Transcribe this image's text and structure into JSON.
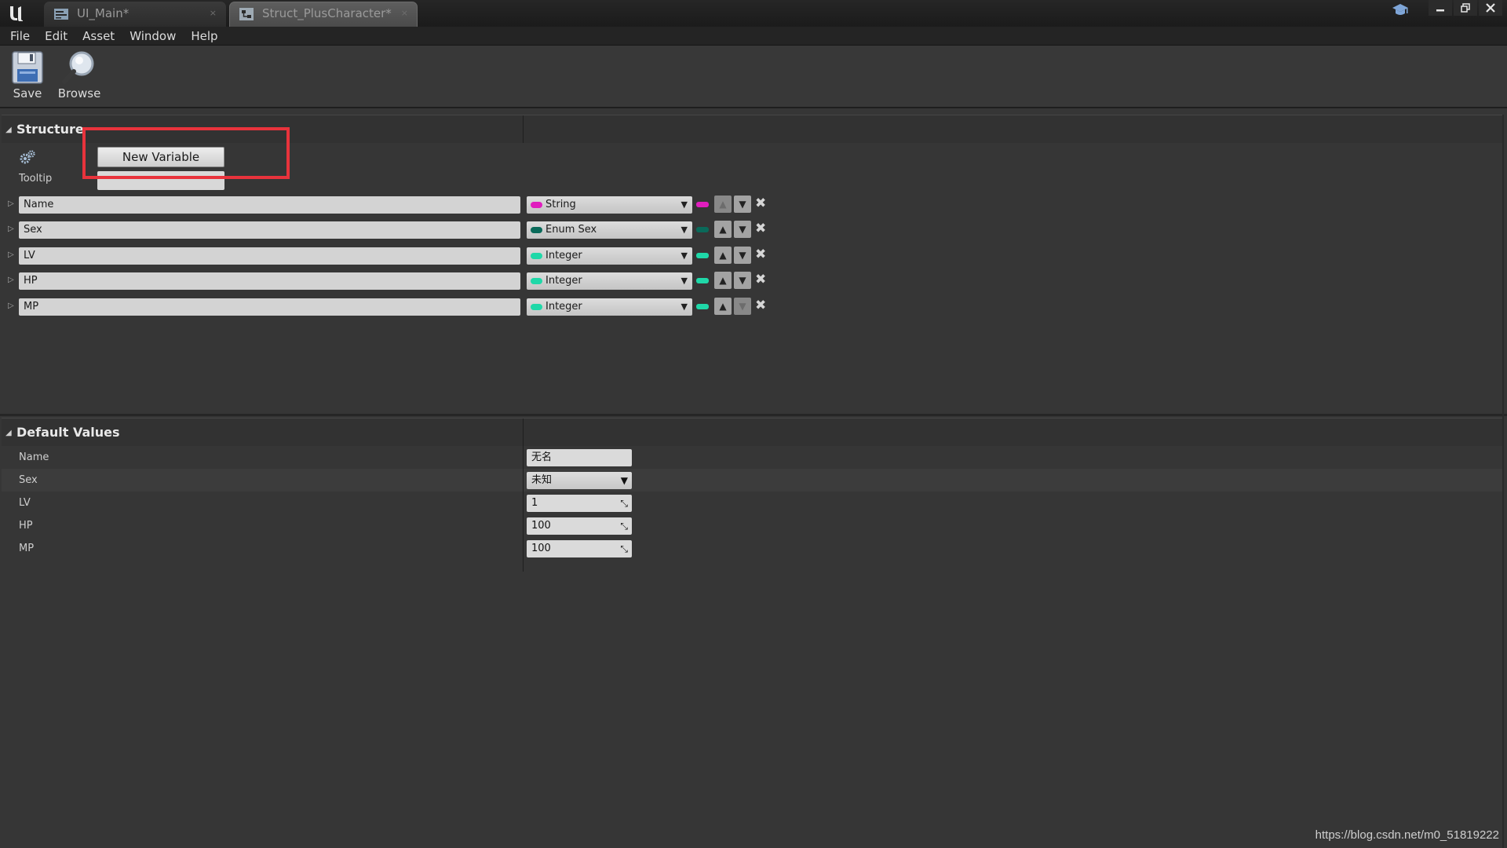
{
  "window": {
    "tabs": [
      {
        "label": "UI_Main*",
        "active": false
      },
      {
        "label": "Struct_PlusCharacter*",
        "active": true
      }
    ],
    "tab_close_glyph": "×",
    "controls": [
      "minimize",
      "restore",
      "close"
    ]
  },
  "menu": {
    "items": [
      "File",
      "Edit",
      "Asset",
      "Window",
      "Help"
    ]
  },
  "toolbar": {
    "save_label": "Save",
    "browse_label": "Browse"
  },
  "structure": {
    "title": "Structure",
    "new_variable_label": "New Variable",
    "tooltip_label": "Tooltip",
    "tooltip_value": "",
    "variables": [
      {
        "name": "Name",
        "type": "String",
        "type_color": "#e01ebe",
        "up_enabled": false,
        "down_enabled": true
      },
      {
        "name": "Sex",
        "type": "Enum Sex",
        "type_color": "#0a6a5a",
        "up_enabled": true,
        "down_enabled": true
      },
      {
        "name": "LV",
        "type": "Integer",
        "type_color": "#1fd8a8",
        "up_enabled": true,
        "down_enabled": true
      },
      {
        "name": "HP",
        "type": "Integer",
        "type_color": "#1fd8a8",
        "up_enabled": true,
        "down_enabled": true
      },
      {
        "name": "MP",
        "type": "Integer",
        "type_color": "#1fd8a8",
        "up_enabled": true,
        "down_enabled": false
      }
    ]
  },
  "defaults": {
    "title": "Default Values",
    "rows": [
      {
        "label": "Name",
        "value": "无名",
        "kind": "text"
      },
      {
        "label": "Sex",
        "value": "未知",
        "kind": "combo"
      },
      {
        "label": "LV",
        "value": "1",
        "kind": "number"
      },
      {
        "label": "HP",
        "value": "100",
        "kind": "number"
      },
      {
        "label": "MP",
        "value": "100",
        "kind": "number"
      }
    ]
  },
  "watermark": "https://blog.csdn.net/m0_51819222",
  "icons": {
    "logo": "unreal-logo-icon",
    "save": "floppy-disk-icon",
    "browse": "magnifier-icon",
    "settings": "gears-icon",
    "learn": "graduation-cap-icon"
  },
  "colors": {
    "highlight": "#e8333c",
    "background": "#363636"
  }
}
